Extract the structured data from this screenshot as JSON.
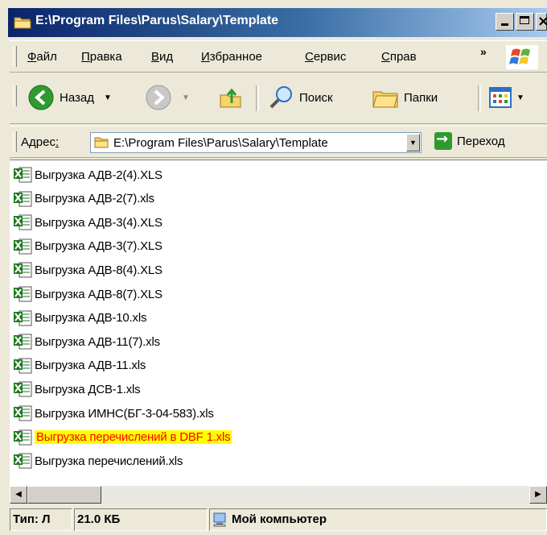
{
  "window": {
    "title": "E:\\Program Files\\Parus\\Salary\\Template"
  },
  "menu": [
    {
      "acc": "Ф",
      "rest": "айл"
    },
    {
      "acc": "П",
      "rest": "равка"
    },
    {
      "acc": "В",
      "rest": "ид"
    },
    {
      "acc": "И",
      "rest": "збранное"
    },
    {
      "acc": "С",
      "rest": "ервис"
    },
    {
      "acc": "С",
      "rest": "прав"
    }
  ],
  "menu_overflow": "»",
  "toolbar": {
    "back_label": "Назад",
    "search_label": "Поиск",
    "folders_label": "Папки"
  },
  "address": {
    "label_main": "Адрес",
    "label_acc": ":",
    "value": "E:\\Program Files\\Parus\\Salary\\Template",
    "go_label": "Переход"
  },
  "files": [
    "Выгрузка АДВ-2(4).XLS",
    "Выгрузка АДВ-2(7).xls",
    "Выгрузка АДВ-3(4).XLS",
    "Выгрузка АДВ-3(7).XLS",
    "Выгрузка АДВ-8(4).XLS",
    "Выгрузка АДВ-8(7).XLS",
    "Выгрузка АДВ-10.xls",
    "Выгрузка АДВ-11(7).xls",
    "Выгрузка АДВ-11.xls",
    "Выгрузка ДСВ-1.xls",
    "Выгрузка ИМНС(БГ-3-04-583).xls",
    "Выгрузка перечислений в DBF 1.xls",
    "Выгрузка перечислений.xls"
  ],
  "selected_index": 11,
  "status": {
    "type": "Тип: Л",
    "size": "21.0 КБ",
    "location": "Мой компьютер"
  },
  "colors": {
    "selection_bg": "#ffff00",
    "selection_text": "#ff0000",
    "title_gradient_start": "#0a246a"
  }
}
